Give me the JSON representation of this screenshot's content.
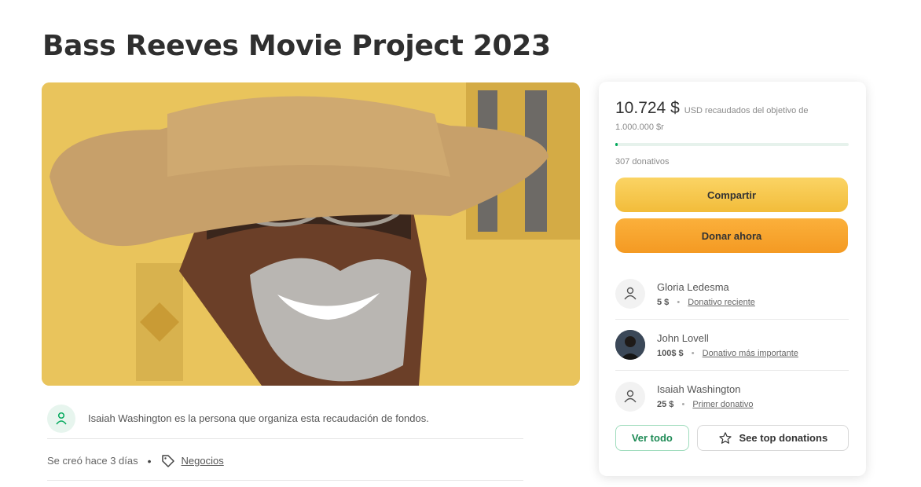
{
  "page": {
    "title": "Bass Reeves Movie Project 2023"
  },
  "organizer": {
    "text": "Isaiah Washington es la persona que organiza esta recaudación de fondos."
  },
  "meta": {
    "created": "Se creó hace 3 días",
    "separator": "•",
    "category": "Negocios"
  },
  "summary": {
    "raised_amount": "10.724 $",
    "raised_text": "USD recaudados del objetivo de",
    "goal": "1.000.000 $r",
    "progress_fraction": 0.011,
    "donations_count": "307 donativos"
  },
  "buttons": {
    "share": "Compartir",
    "donate": "Donar ahora",
    "view_all": "Ver todo",
    "top_donations": "See top donations"
  },
  "donors": [
    {
      "name": "Gloria Ledesma",
      "amount": "5 $",
      "label": "Donativo reciente",
      "avatar": "person-icon"
    },
    {
      "name": "John Lovell",
      "amount": "100$ $",
      "label": "Donativo más importante",
      "avatar": "photo"
    },
    {
      "name": "Isaiah Washington",
      "amount": "25 $",
      "label": "Primer donativo",
      "avatar": "person-icon"
    }
  ],
  "colors": {
    "accent": "#02a95c",
    "share": "#f6c84c",
    "donate": "#f7a531"
  }
}
